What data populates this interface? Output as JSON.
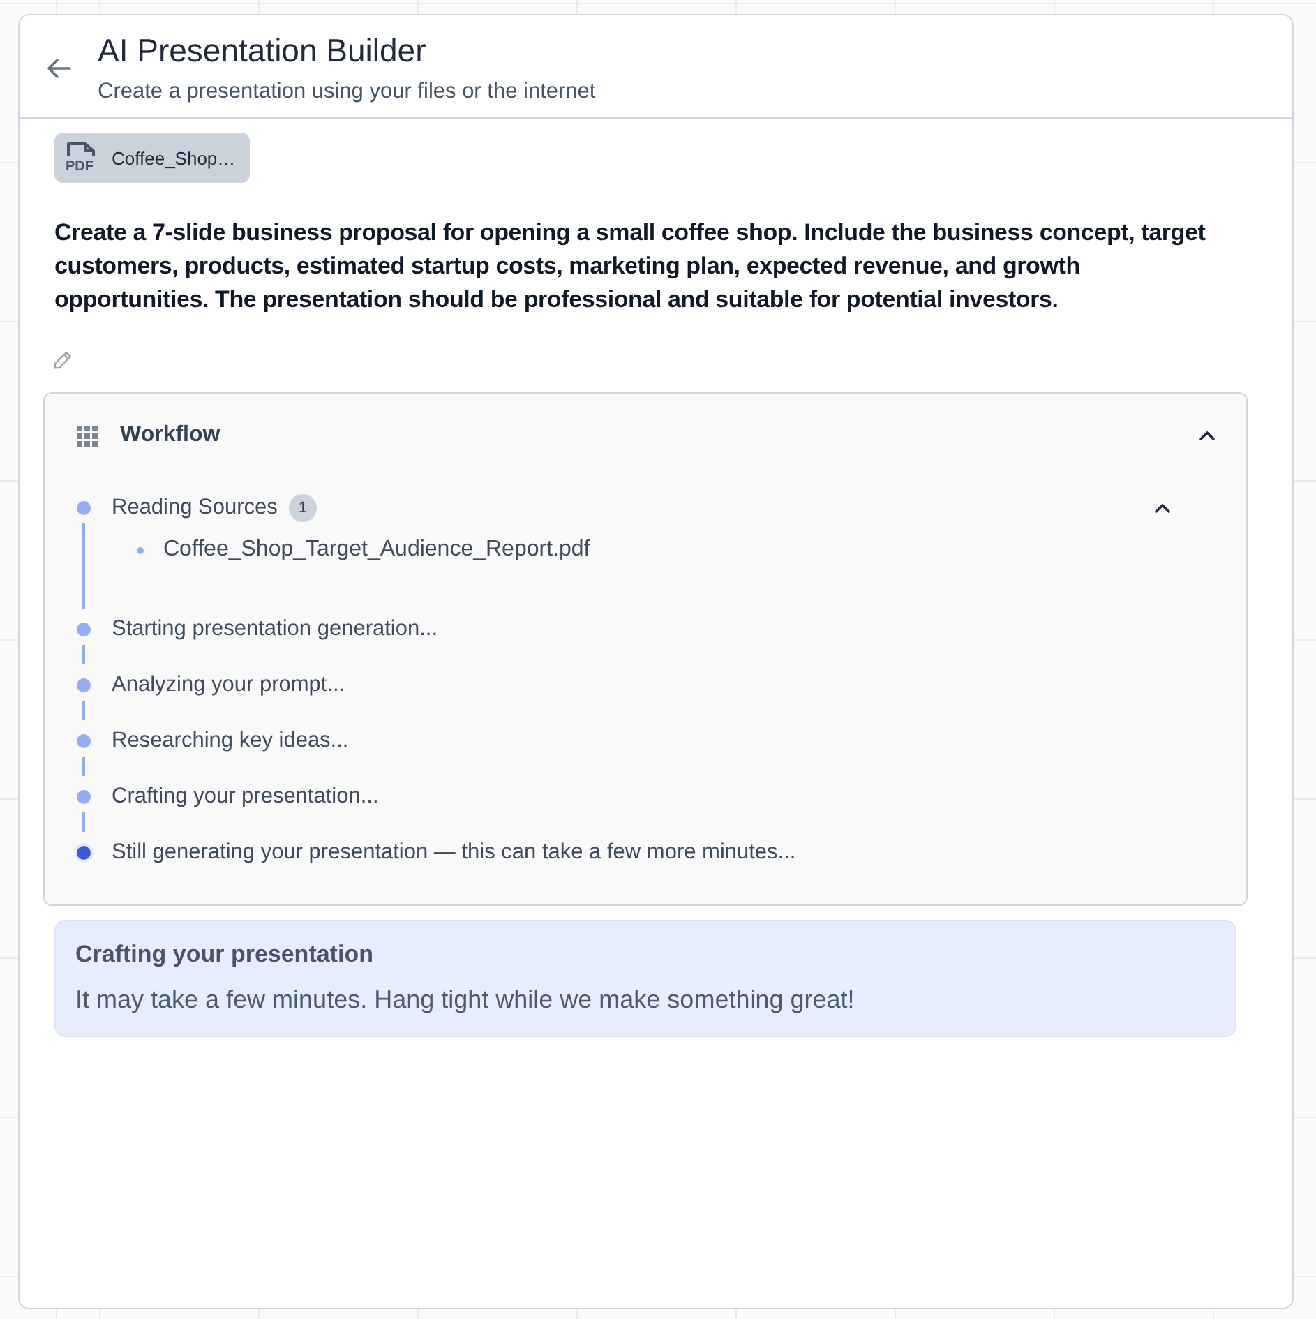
{
  "header": {
    "title": "AI Presentation Builder",
    "subtitle": "Create a presentation using your files or the internet"
  },
  "attachments": [
    {
      "kind": "pdf",
      "type_label": "PDF",
      "name": "Coffee_Shop…"
    }
  ],
  "prompt": "Create a 7-slide business proposal for opening a small coffee shop. Include the business concept, target customers, products, estimated startup costs, marketing plan, expected revenue, and growth opportunities. The presentation should be professional and suitable for potential investors.",
  "workflow": {
    "title": "Workflow",
    "expanded": true,
    "steps": [
      {
        "label": "Reading Sources",
        "count": "1",
        "active": false,
        "expanded": true,
        "children": [
          {
            "label": "Coffee_Shop_Target_Audience_Report.pdf"
          }
        ]
      },
      {
        "label": "Starting presentation generation...",
        "active": false
      },
      {
        "label": "Analyzing your prompt...",
        "active": false
      },
      {
        "label": "Researching key ideas...",
        "active": false
      },
      {
        "label": "Crafting your presentation...",
        "active": false
      },
      {
        "label": "Still generating your presentation — this can take a few more minutes...",
        "active": true
      }
    ]
  },
  "notice": {
    "title": "Crafting your presentation",
    "message": "It may take a few minutes. Hang tight while we make something great!"
  }
}
